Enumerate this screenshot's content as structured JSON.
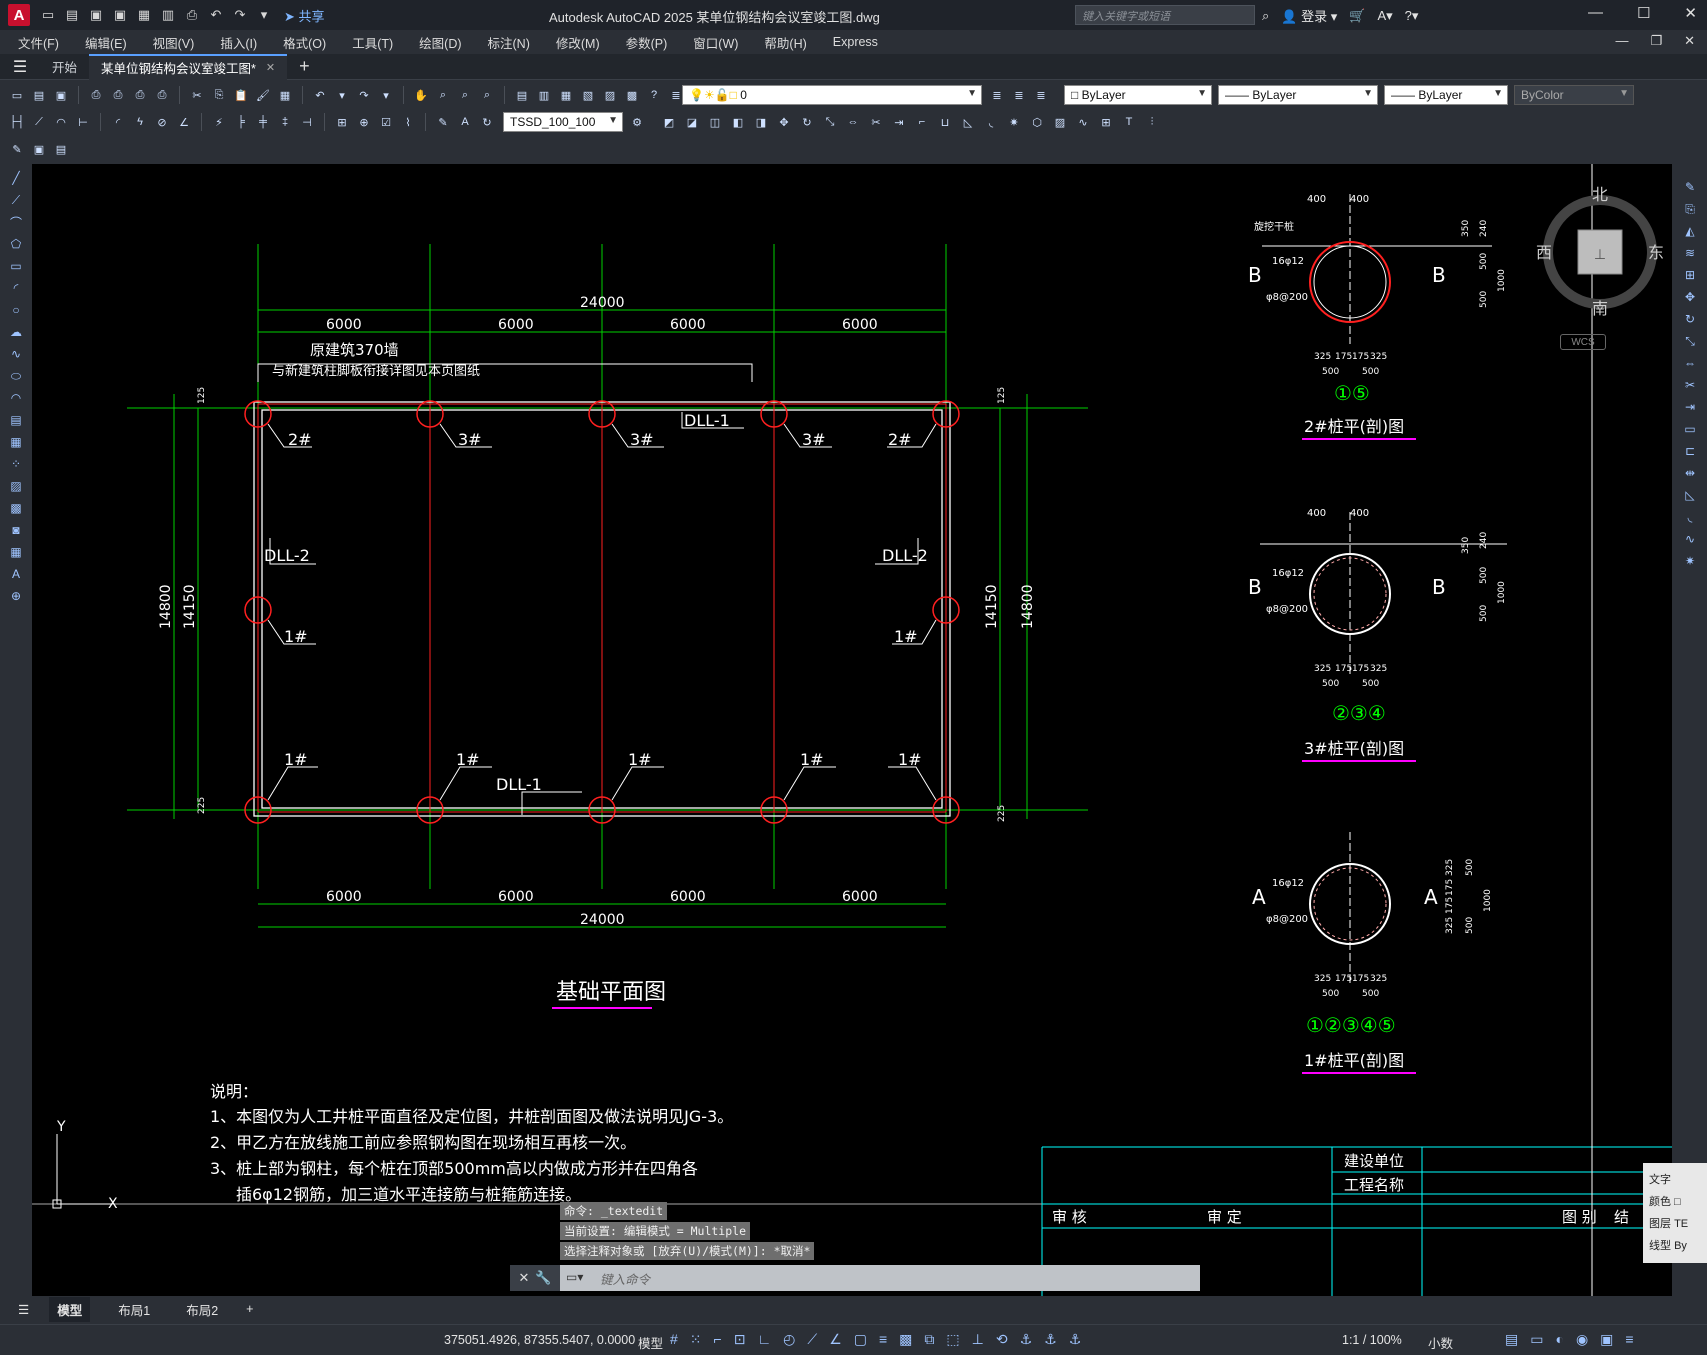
{
  "app": {
    "logo": "A",
    "title": "Autodesk AutoCAD 2025    某单位钢结构会议室竣工图.dwg",
    "share": "共享",
    "search_placeholder": "键入关键字或短语",
    "login": "登录"
  },
  "menu": [
    "文件(F)",
    "编辑(E)",
    "视图(V)",
    "插入(I)",
    "格式(O)",
    "工具(T)",
    "绘图(D)",
    "标注(N)",
    "修改(M)",
    "参数(P)",
    "窗口(W)",
    "帮助(H)",
    "Express"
  ],
  "tabs": {
    "start": "开始",
    "file": "某单位钢结构会议室竣工图*"
  },
  "toolbar": {
    "layer": "0",
    "color": "ByLayer",
    "linetype": "ByLayer",
    "lineweight": "ByLayer",
    "plotstyle": "ByColor",
    "dimstyle": "TSSD_100_100"
  },
  "viewcube": {
    "n": "北",
    "s": "南",
    "e": "东",
    "w": "西",
    "wcs": "WCS"
  },
  "plan": {
    "title": "基础平面图",
    "dims_spans": [
      "6000",
      "6000",
      "6000",
      "6000"
    ],
    "dim_total": "24000",
    "dim_left_outer": "14800",
    "dim_left_inner": "14150",
    "dim_right_inner": "14150",
    "dim_right_outer": "14800",
    "small_dim": "125",
    "small_dim2": "225",
    "note_wall": "原建筑370墙",
    "note_wall2": "与新建筑柱脚板衔接详图见本页图纸",
    "beams": {
      "top": "DLL-1",
      "bottom": "DLL-1",
      "left": "DLL-2",
      "right": "DLL-2"
    },
    "piles_top": [
      "2#",
      "3#",
      "3#",
      "3#",
      "2#"
    ],
    "piles_mid": [
      "1#",
      "1#"
    ],
    "piles_bottom": [
      "1#",
      "1#",
      "1#",
      "1#",
      "1#"
    ]
  },
  "details": [
    {
      "title": "2#桩平(剖)图",
      "circ": "①⑤",
      "top": [
        "400",
        "400"
      ],
      "rebar": "16φ12",
      "stirrup": "φ8@200",
      "section": "B",
      "side": [
        "350",
        "240",
        "500",
        "500",
        "1000"
      ],
      "bottom": [
        "325",
        "175",
        "175",
        "325"
      ],
      "bottom2": [
        "500",
        "500"
      ],
      "label": "旋挖干桩"
    },
    {
      "title": "3#桩平(剖)图",
      "circ": "②③④",
      "top": [
        "400",
        "400"
      ],
      "rebar": "16φ12",
      "stirrup": "φ8@200",
      "section": "B",
      "side": [
        "350",
        "240",
        "500",
        "500",
        "1000"
      ],
      "bottom": [
        "325",
        "175",
        "175",
        "325"
      ],
      "bottom2": [
        "500",
        "500"
      ]
    },
    {
      "title": "1#桩平(剖)图",
      "circ": "①②③④⑤",
      "rebar": "16φ12",
      "stirrup": "φ8@200",
      "section": "A",
      "side": [
        "325",
        "175",
        "175",
        "325",
        "500",
        "500",
        "1000"
      ],
      "bottom": [
        "325",
        "175",
        "175",
        "325"
      ],
      "bottom2": [
        "500",
        "500"
      ]
    }
  ],
  "notes": {
    "head": "说明：",
    "l1": "1、本图仅为人工井桩平面直径及定位图，井桩剖面图及做法说明见JG-3。",
    "l2": "2、甲乙方在放线施工前应参照钢构图在现场相互再核一次。",
    "l3": "3、桩上部为钢柱，每个桩在顶部500mm高以内做成方形并在四角各",
    "l4": "插6φ12钢筋，加三道水平连接筋与桩箍筋连接。"
  },
  "titleblock": {
    "unit": "建设单位",
    "project": "工程名称",
    "review": "审 核",
    "check": "审 定",
    "drawing": "图 别",
    "struct": "结"
  },
  "command": {
    "h1": "命令: _textedit",
    "h2": "当前设置: 编辑模式 = Multiple",
    "h3": "选择注释对象或 [放弃(U)/模式(M)]: *取消*",
    "placeholder": "键入命令"
  },
  "props": {
    "title": "文字",
    "color": "颜色",
    "layer": "图层",
    "ltype": "线型",
    "layer_val": "TE",
    "ltype_val": "By"
  },
  "layouts": [
    "模型",
    "布局1",
    "布局2"
  ],
  "status": {
    "coords": "375051.4926, 87355.5407, 0.0000",
    "model": "模型",
    "scale": "1:1 / 100%",
    "units": "小数"
  }
}
